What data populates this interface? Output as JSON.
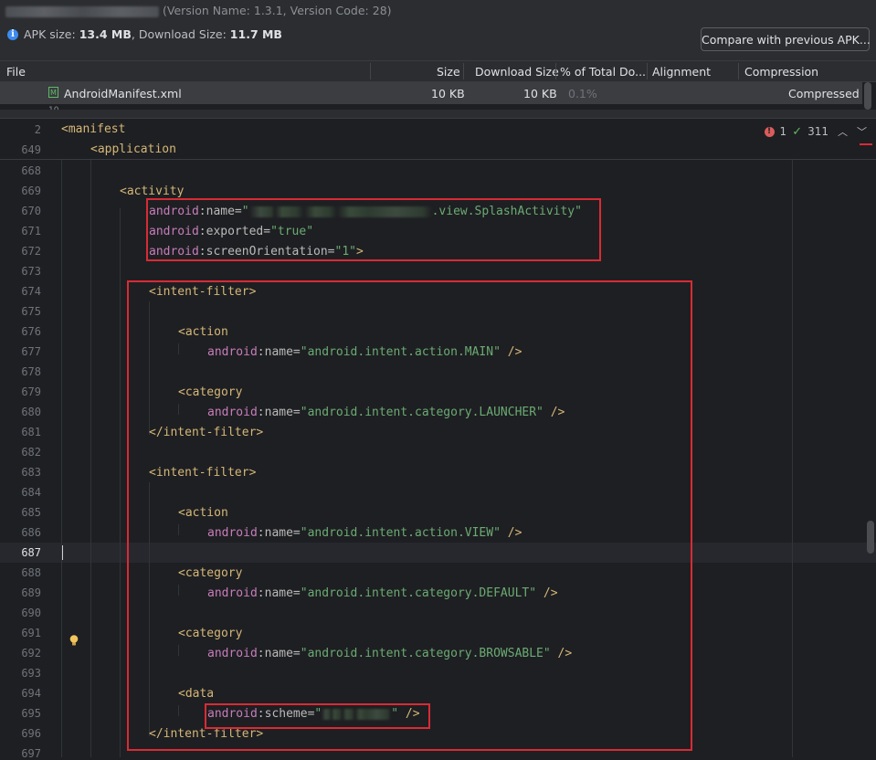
{
  "apk": {
    "version_text": "(Version Name: 1.3.1, Version Code: 28)",
    "size_label": "APK size:",
    "apk_size": "13.4 MB",
    "download_label": ", Download Size:",
    "download_size": "11.7 MB",
    "compare_button": "Compare with previous APK..."
  },
  "table": {
    "columns": [
      "File",
      "Size",
      "Download Size",
      "% of Total Do...",
      "Alignment",
      "Compression"
    ],
    "row": {
      "name": "AndroidManifest.xml",
      "size": "10 KB",
      "download_size": "10 KB",
      "percent": "0.1%",
      "alignment": "",
      "compression": "Compressed"
    },
    "partial_row": "10"
  },
  "editor": {
    "sticky": [
      {
        "line": "2",
        "text": "<manifest"
      },
      {
        "line": "649",
        "text": "<application"
      }
    ],
    "inspections": {
      "errors": "1",
      "ok": "311"
    },
    "line_numbers": [
      "668",
      "669",
      "670",
      "671",
      "672",
      "673",
      "674",
      "675",
      "676",
      "677",
      "678",
      "679",
      "680",
      "681",
      "682",
      "683",
      "684",
      "685",
      "686",
      "687",
      "688",
      "689",
      "690",
      "691",
      "692",
      "693",
      "694",
      "695",
      "696",
      "697"
    ],
    "current_line": "687",
    "tokens": {
      "activity": "activity",
      "android": "android",
      "name_attr": ":name=",
      "exported_attr": ":exported=",
      "orientation_attr": ":screenOrientation=",
      "scheme_attr": ":scheme=",
      "splash_suffix": ".view.SplashActivity",
      "exported_val": "\"true\"",
      "orientation_val": "\"1\"",
      "intent_filter": "intent-filter",
      "action": "action",
      "category": "category",
      "data": "data",
      "action_main": "\"android.intent.action.MAIN\"",
      "category_launcher": "\"android.intent.category.LAUNCHER\"",
      "action_view": "\"android.intent.action.VIEW\"",
      "category_default": "\"android.intent.category.DEFAULT\"",
      "category_browsable": "\"android.intent.category.BROWSABLE\""
    }
  },
  "colors": {
    "highlight_box": "#d92b35",
    "tag": "#d5b778",
    "namespace": "#c77dbb",
    "string": "#6aab73"
  }
}
